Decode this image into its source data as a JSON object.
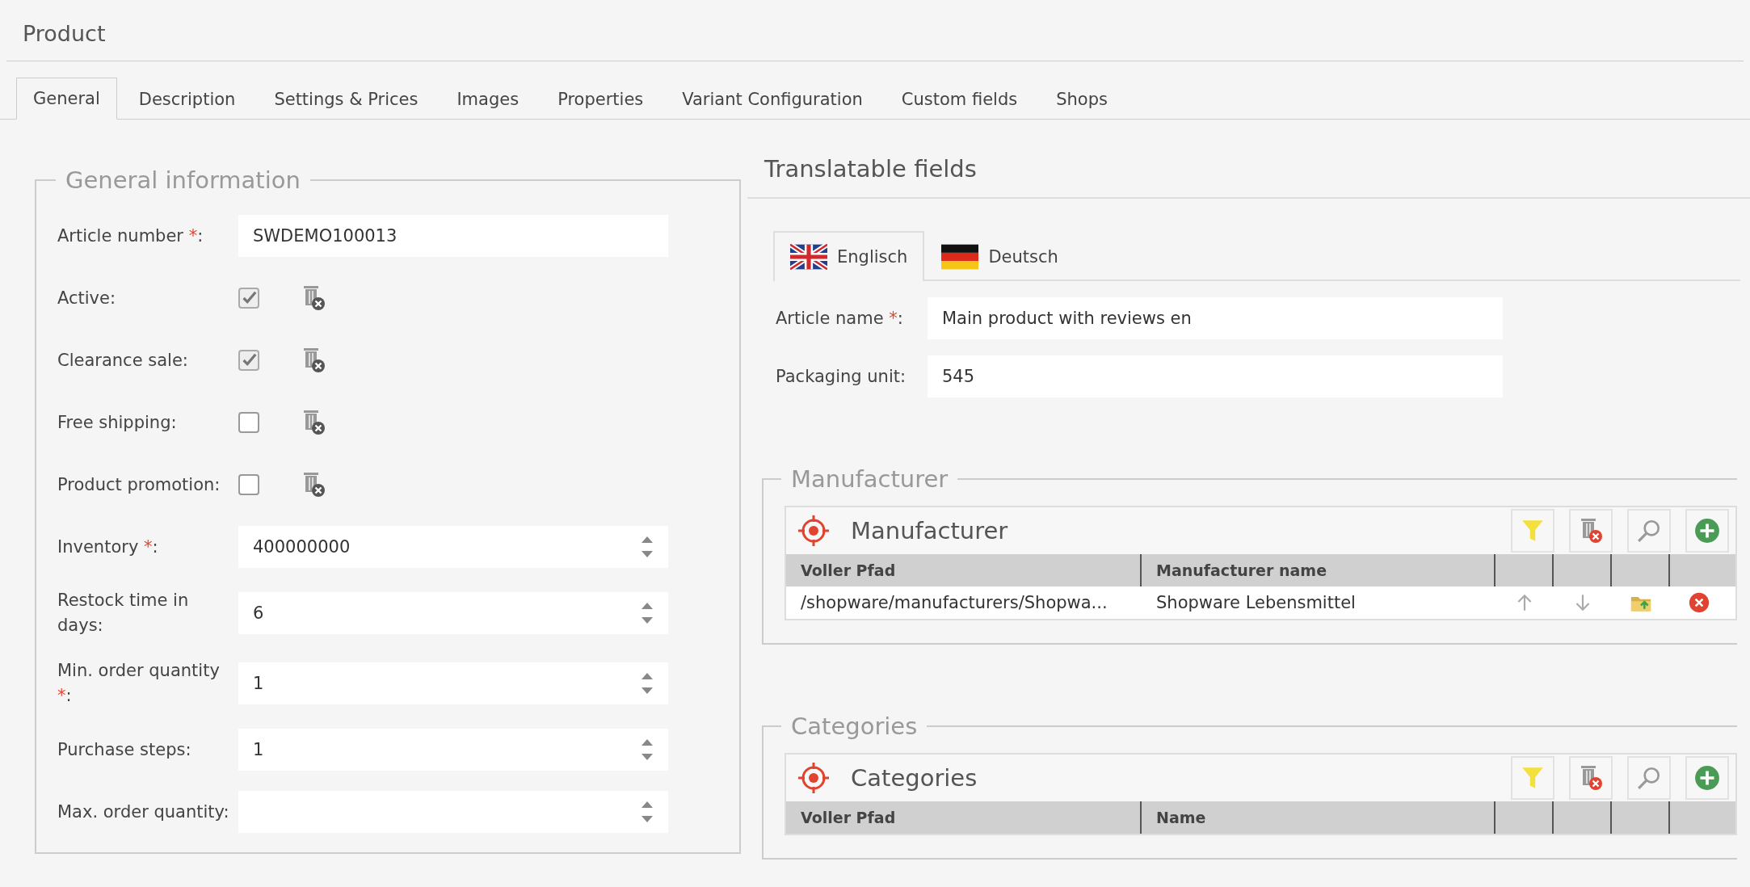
{
  "window": {
    "title": "Product"
  },
  "tabs": [
    {
      "label": "General",
      "selected": true
    },
    {
      "label": "Description",
      "selected": false
    },
    {
      "label": "Settings & Prices",
      "selected": false
    },
    {
      "label": "Images",
      "selected": false
    },
    {
      "label": "Properties",
      "selected": false
    },
    {
      "label": "Variant Configuration",
      "selected": false
    },
    {
      "label": "Custom fields",
      "selected": false
    },
    {
      "label": "Shops",
      "selected": false
    }
  ],
  "general_information": {
    "legend": "General information",
    "fields": [
      {
        "kind": "text",
        "label": "Article number ",
        "required_mark": "*",
        "label_end": ":",
        "value": "SWDEMO100013"
      },
      {
        "kind": "checkbox",
        "label": "Active:",
        "checked": true
      },
      {
        "kind": "checkbox",
        "label": "Clearance sale:",
        "checked": true
      },
      {
        "kind": "checkbox",
        "label": "Free shipping:",
        "checked": false
      },
      {
        "kind": "checkbox",
        "label": "Product promotion:",
        "checked": false
      },
      {
        "kind": "number",
        "label": "Inventory ",
        "required_mark": "*",
        "label_end": ":",
        "value": "400000000"
      },
      {
        "kind": "number",
        "label": "Restock time in days:",
        "value": "6"
      },
      {
        "kind": "number",
        "label": "Min. order quantity ",
        "required_mark": "*",
        "label_end": ":",
        "value": "1"
      },
      {
        "kind": "number",
        "label": "Purchase steps:",
        "value": "1"
      },
      {
        "kind": "number",
        "label": "Max. order quantity:"
      }
    ]
  },
  "translatable_fields": {
    "title": "Translatable fields",
    "languages": [
      {
        "label": "Englisch",
        "kind": "uk",
        "selected": true
      },
      {
        "label": "Deutsch",
        "kind": "de",
        "selected": false
      }
    ],
    "fields": [
      {
        "label": "Article name ",
        "required_mark": "*",
        "label_end": ":",
        "value": "Main product with reviews en"
      },
      {
        "label": "Packaging unit:",
        "value": "545"
      }
    ]
  },
  "associations": [
    {
      "legend": "Manufacturer",
      "title": "Manufacturer",
      "columns": [
        {
          "kind": "text",
          "label": "Voller Pfad"
        },
        {
          "kind": "text",
          "label": "Manufacturer name"
        },
        {
          "kind": "action"
        },
        {
          "kind": "action"
        },
        {
          "kind": "action"
        },
        {
          "kind": "action"
        }
      ],
      "rows": [
        {
          "cells": [
            {
              "kind": "text",
              "text": "/shopware/manufacturers/Shopwa..."
            },
            {
              "kind": "text",
              "text": "Shopware Lebensmittel"
            },
            {
              "kind": "move_up"
            },
            {
              "kind": "move_down"
            },
            {
              "kind": "open"
            },
            {
              "kind": "remove"
            }
          ]
        }
      ]
    },
    {
      "legend": "Categories",
      "title": "Categories",
      "columns": [
        {
          "kind": "text",
          "label": "Voller Pfad"
        },
        {
          "kind": "text",
          "label": "Name"
        },
        {
          "kind": "action"
        },
        {
          "kind": "action"
        },
        {
          "kind": "action"
        },
        {
          "kind": "action"
        }
      ]
    }
  ]
}
